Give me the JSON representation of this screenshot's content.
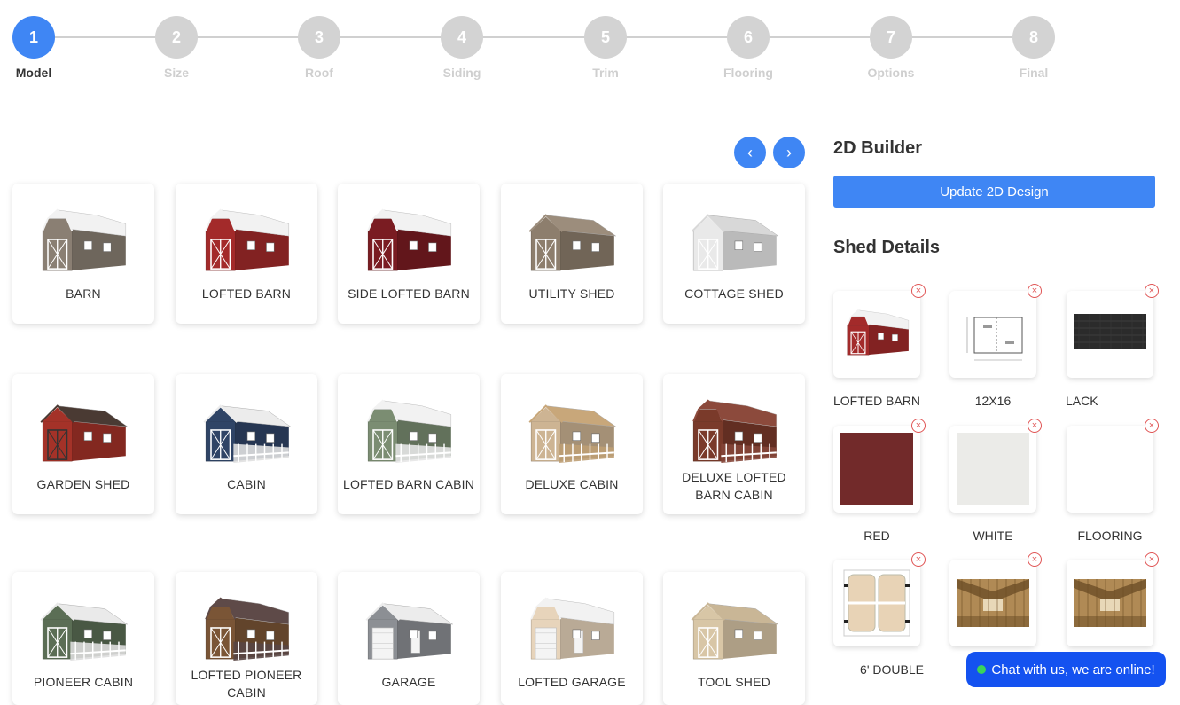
{
  "steps": [
    {
      "num": "1",
      "label": "Model",
      "active": true
    },
    {
      "num": "2",
      "label": "Size"
    },
    {
      "num": "3",
      "label": "Roof"
    },
    {
      "num": "4",
      "label": "Siding"
    },
    {
      "num": "5",
      "label": "Trim"
    },
    {
      "num": "6",
      "label": "Flooring"
    },
    {
      "num": "7",
      "label": "Options"
    },
    {
      "num": "8",
      "label": "Final"
    }
  ],
  "nav": {
    "prev_icon": "chevron-left-icon",
    "next_icon": "chevron-right-icon",
    "prev": "‹",
    "next": "›"
  },
  "models": [
    {
      "name": "BARN",
      "icon": "barn-shed",
      "colors": {
        "wall": "#8a7f73",
        "roof": "#f2f2f2",
        "trim": "#ffffff"
      }
    },
    {
      "name": "LOFTED BARN",
      "icon": "lofted-barn",
      "colors": {
        "wall": "#a32a2a",
        "roof": "#f2f2f2",
        "trim": "#ffffff"
      }
    },
    {
      "name": "SIDE LOFTED BARN",
      "icon": "side-lofted-barn",
      "colors": {
        "wall": "#7a1c22",
        "roof": "#f2f2f2",
        "trim": "#ffffff"
      }
    },
    {
      "name": "UTILITY SHED",
      "icon": "utility-shed",
      "colors": {
        "wall": "#8d7e6d",
        "roof": "#9c8d7c",
        "trim": "#ffffff"
      }
    },
    {
      "name": "COTTAGE SHED",
      "icon": "cottage-shed",
      "colors": {
        "wall": "#e9e9e9",
        "roof": "#d8d8d8",
        "trim": "#ffffff"
      }
    },
    {
      "name": "GARDEN SHED",
      "icon": "garden-shed",
      "colors": {
        "wall": "#a43228",
        "roof": "#4a3a33",
        "trim": "#333333"
      }
    },
    {
      "name": "CABIN",
      "icon": "cabin",
      "colors": {
        "wall": "#2f4466",
        "roof": "#ececec",
        "trim": "#ffffff"
      }
    },
    {
      "name": "LOFTED BARN CABIN",
      "icon": "lofted-barn-cabin",
      "colors": {
        "wall": "#7b8d72",
        "roof": "#f2f2f2",
        "trim": "#ffffff"
      }
    },
    {
      "name": "DELUXE CABIN",
      "icon": "deluxe-cabin",
      "colors": {
        "wall": "#cdb493",
        "roof": "#c8a77a",
        "trim": "#ffffff"
      }
    },
    {
      "name": "DELUXE LOFTED BARN CABIN",
      "icon": "deluxe-lofted-barn-cabin",
      "colors": {
        "wall": "#7a3a2a",
        "roof": "#8c4a3c",
        "trim": "#ffffff"
      }
    },
    {
      "name": "PIONEER CABIN",
      "icon": "pioneer-cabin",
      "colors": {
        "wall": "#5b6e55",
        "roof": "#eaeaea",
        "trim": "#ffffff"
      }
    },
    {
      "name": "LOFTED PIONEER CABIN",
      "icon": "lofted-pioneer-cabin",
      "colors": {
        "wall": "#7a5536",
        "roof": "#5e4a48",
        "trim": "#ffffff"
      }
    },
    {
      "name": "GARAGE",
      "icon": "garage",
      "colors": {
        "wall": "#8c8f94",
        "roof": "#ececec",
        "trim": "#ffffff"
      }
    },
    {
      "name": "LOFTED GARAGE",
      "icon": "lofted-garage",
      "colors": {
        "wall": "#e7d4bb",
        "roof": "#f2f2f2",
        "trim": "#ffffff"
      }
    },
    {
      "name": "TOOL SHED",
      "icon": "tool-shed",
      "colors": {
        "wall": "#d8c6a6",
        "roof": "#c9b696",
        "trim": "#ffffff"
      }
    }
  ],
  "builder": {
    "title": "2D Builder",
    "update_label": "Update 2D Design"
  },
  "details": {
    "title": "Shed Details",
    "items": [
      {
        "label": "LOFTED BARN",
        "kind": "shed",
        "color": "#a32a2a"
      },
      {
        "label": "12X16",
        "kind": "floorplan"
      },
      {
        "label": "LACK",
        "kind": "shingle",
        "color": "#2b2b2b"
      },
      {
        "label": "RED",
        "kind": "swatch",
        "color": "#722a2a"
      },
      {
        "label": "WHITE",
        "kind": "swatch",
        "color": "#ebebe8"
      },
      {
        "label": "FLOORING",
        "kind": "blank"
      },
      {
        "label": "6' DOUBLE",
        "kind": "doors"
      },
      {
        "label": "",
        "kind": "loft"
      },
      {
        "label": "",
        "kind": "loft"
      }
    ],
    "remove_symbol": "×"
  },
  "chat": {
    "label": "Chat with us, we are online!"
  },
  "colors": {
    "accent": "#3f86f4",
    "chat_bg": "#1452f0",
    "remove": "#e05555",
    "online": "#3ad45b"
  }
}
